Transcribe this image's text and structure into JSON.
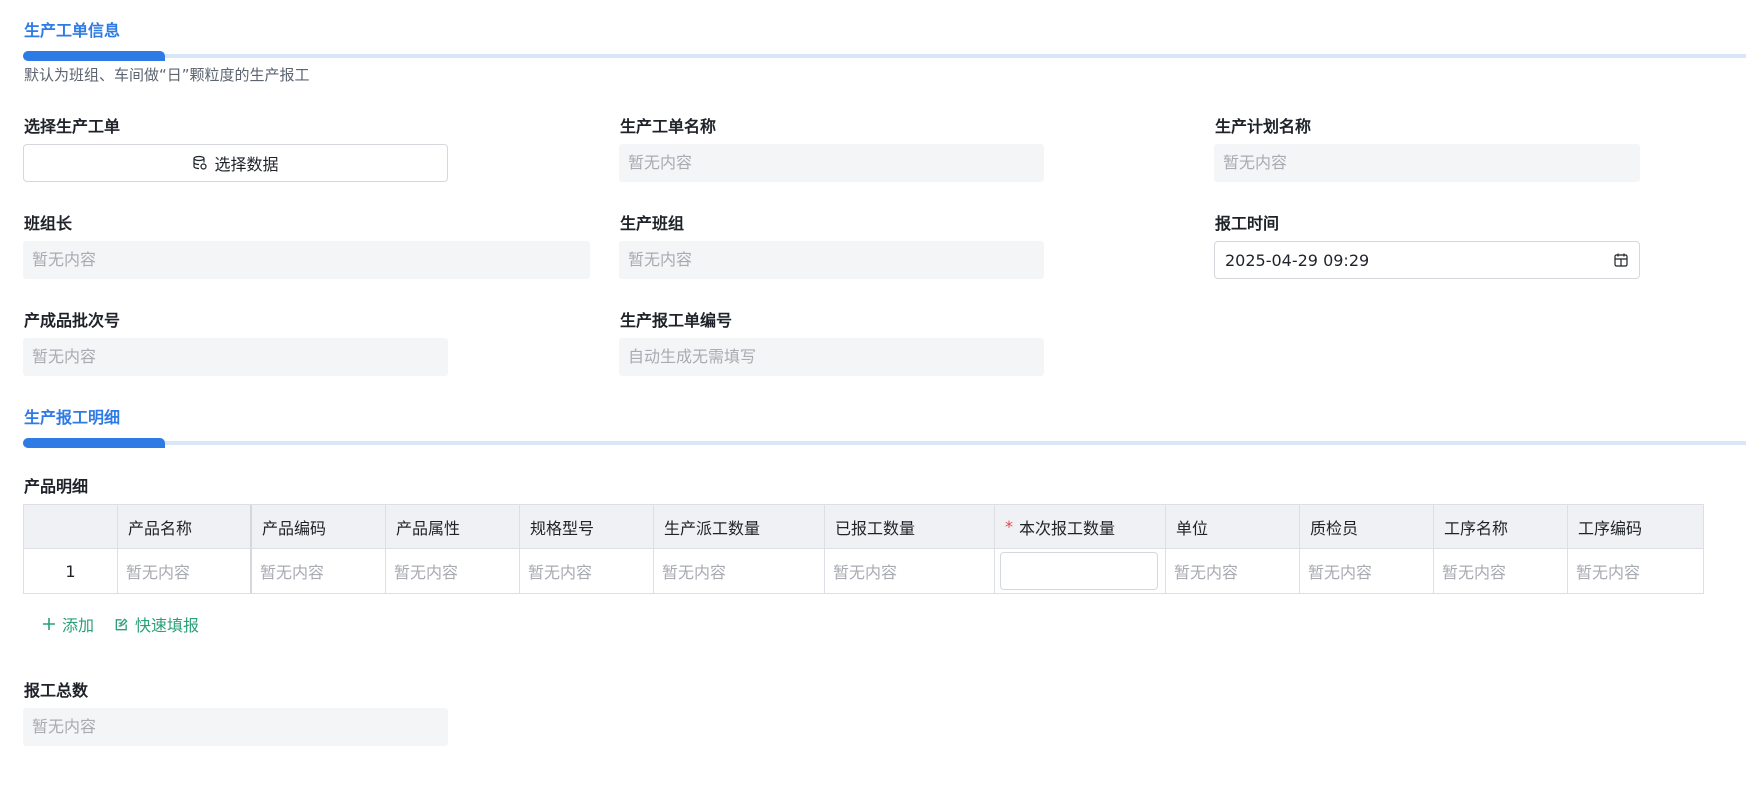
{
  "section1": {
    "title": "生产工单信息",
    "description": "默认为班组、车间做“日”颗粒度的生产报工"
  },
  "form": {
    "select_order_label": "选择生产工单",
    "select_data_button": "选择数据",
    "order_name_label": "生产工单名称",
    "order_name_placeholder": "暂无内容",
    "plan_name_label": "生产计划名称",
    "plan_name_placeholder": "暂无内容",
    "team_leader_label": "班组长",
    "team_leader_placeholder": "暂无内容",
    "team_label": "生产班组",
    "team_placeholder": "暂无内容",
    "report_time_label": "报工时间",
    "report_time_value": "2025-04-29 09:29",
    "batch_label": "产成品批次号",
    "batch_placeholder": "暂无内容",
    "report_no_label": "生产报工单编号",
    "report_no_placeholder": "自动生成无需填写"
  },
  "section2": {
    "title": "生产报工明细"
  },
  "details": {
    "label": "产品明细",
    "columns": [
      "",
      "产品名称",
      "产品编码",
      "产品属性",
      "规格型号",
      "生产派工数量",
      "已报工数量",
      "本次报工数量",
      "单位",
      "质检员",
      "工序名称",
      "工序编码"
    ],
    "required_mark": "*",
    "row": {
      "index": "1",
      "product_name": "暂无内容",
      "product_code": "暂无内容",
      "product_attr": "暂无内容",
      "spec": "暂无内容",
      "dispatch_qty": "暂无内容",
      "reported_qty": "暂无内容",
      "unit": "暂无内容",
      "inspector": "暂无内容",
      "process_name": "暂无内容",
      "process_code": "暂无内容"
    },
    "add_label": "添加",
    "quick_fill_label": "快速填报"
  },
  "total": {
    "label": "报工总数",
    "placeholder": "暂无内容"
  },
  "colors": {
    "accent": "#2f7be5",
    "action": "#2aa07a",
    "required": "#e5484d",
    "field_bg": "#f4f5f7"
  }
}
